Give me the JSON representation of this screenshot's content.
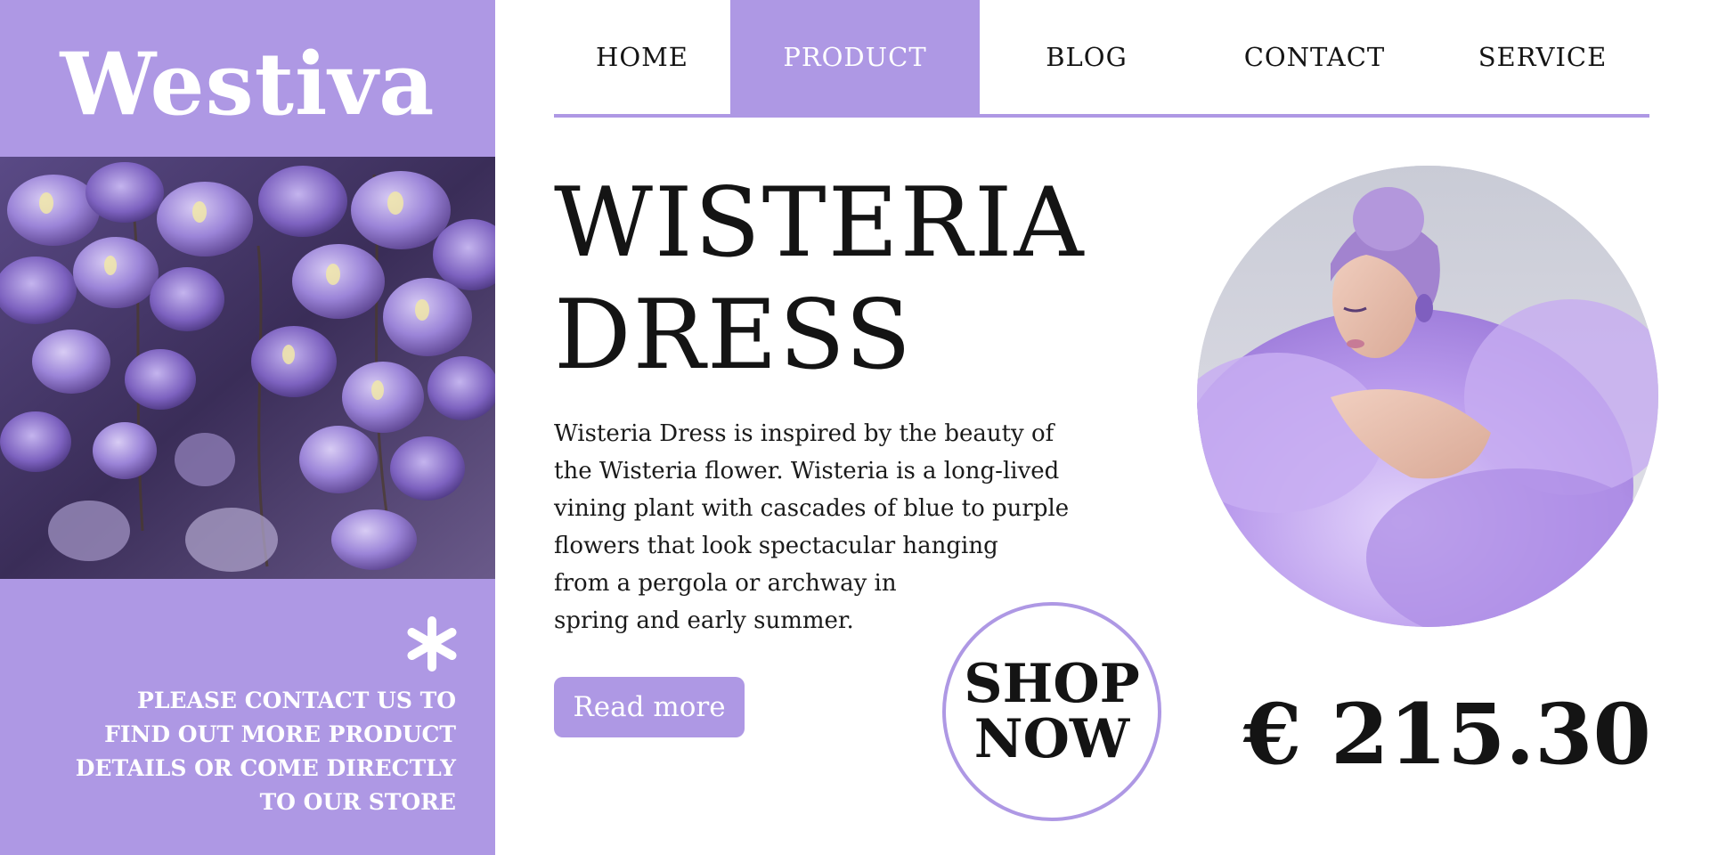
{
  "brand": {
    "logo_text": "Westiva",
    "accent_color": "#ae98e4"
  },
  "nav": {
    "items": [
      {
        "label": "HOME",
        "active": false
      },
      {
        "label": "PRODUCT",
        "active": true
      },
      {
        "label": "BLOG",
        "active": false
      },
      {
        "label": "CONTACT",
        "active": false
      },
      {
        "label": "SERVICE",
        "active": false
      }
    ]
  },
  "sidebar": {
    "photo_icon": "wisteria-flower-photo",
    "decor_icon": "asterisk-icon",
    "note_lines": [
      "PLEASE CONTACT US TO",
      "FIND OUT MORE PRODUCT",
      "DETAILS OR COME DIRECTLY",
      "TO OUR STORE"
    ]
  },
  "product": {
    "title_lines": [
      "WISTERIA",
      "DRESS"
    ],
    "description_lines": [
      "Wisteria Dress is inspired by the beauty of",
      "the Wisteria flower. Wisteria is a long-lived",
      "vining plant with cascades of blue to purple",
      "flowers that look spectacular hanging",
      "from a pergola or archway in",
      "spring and early summer."
    ],
    "read_more_label": "Read more",
    "shop_now_lines": [
      "SHOP",
      "NOW"
    ],
    "price": "€ 215.30",
    "photo_icon": "model-in-lilac-tulle-dress-photo"
  }
}
